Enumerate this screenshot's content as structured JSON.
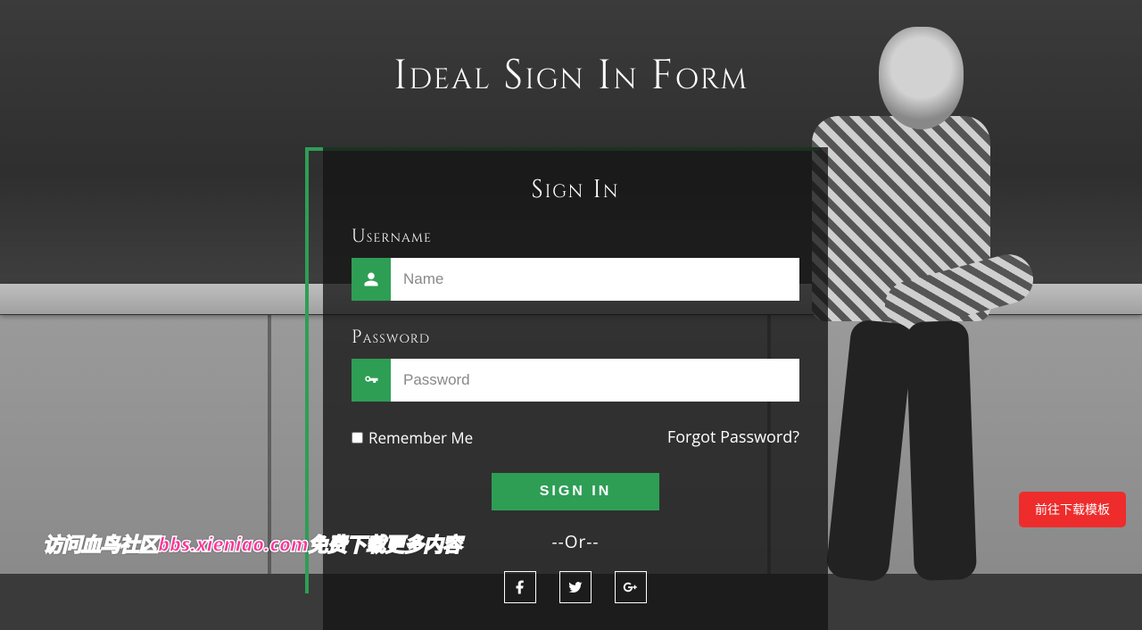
{
  "page": {
    "title": "Ideal Sign In Form"
  },
  "form": {
    "heading": "Sign In",
    "username_label": "Username",
    "username_placeholder": "Name",
    "username_value": "",
    "password_label": "Password",
    "password_placeholder": "Password",
    "password_value": "",
    "remember_label": "Remember Me",
    "forgot_label": "Forgot Password?",
    "submit_label": "SIGN IN",
    "or_label": "--Or--"
  },
  "social": {
    "facebook": "facebook-icon",
    "twitter": "twitter-icon",
    "google_plus": "google-plus-icon"
  },
  "colors": {
    "accent": "#2e9e55",
    "danger": "#ee2c2c",
    "watermark": "#ff3399"
  },
  "overlay": {
    "download_label": "前往下载模板",
    "watermark_text": "访问血鸟社区bbs.xieniao.com免费下载更多内容"
  }
}
